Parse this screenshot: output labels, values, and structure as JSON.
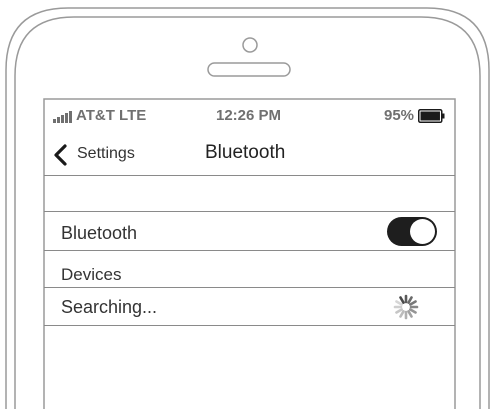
{
  "status_bar": {
    "carrier": "AT&T LTE",
    "time": "12:26 PM",
    "battery_percent": "95%",
    "battery_level": 0.95,
    "signal_icon": "signal-bars-icon",
    "battery_icon": "battery-icon"
  },
  "nav": {
    "back_label": "Settings",
    "back_icon": "chevron-left-icon",
    "title": "Bluetooth"
  },
  "settings": {
    "bluetooth_label": "Bluetooth",
    "bluetooth_enabled": true
  },
  "devices": {
    "header": "Devices",
    "status_label": "Searching...",
    "status_icon": "loading-spinner-icon"
  },
  "colors": {
    "toggle_on": "#1e1e1e",
    "outline": "#8a8a8a",
    "status_text": "#707070"
  }
}
